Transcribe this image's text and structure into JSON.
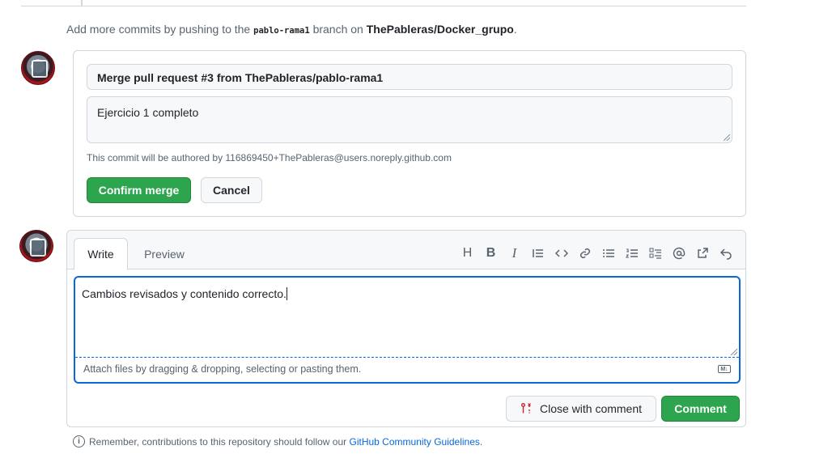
{
  "push_note": {
    "prefix": "Add more commits by pushing to the",
    "branch": "pablo-rama1",
    "middle": "branch on",
    "repo": "ThePableras/Docker_grupo",
    "suffix": "."
  },
  "merge": {
    "title_value": "Merge pull request #3 from ThePableras/pablo-rama1",
    "body_value": "Ejercicio 1 completo",
    "author_note": "This commit will be authored by 116869450+ThePableras@users.noreply.github.com",
    "confirm_label": "Confirm merge",
    "cancel_label": "Cancel"
  },
  "comment": {
    "tabs": [
      {
        "label": "Write",
        "active": true
      },
      {
        "label": "Preview",
        "active": false
      }
    ],
    "toolbar": [
      "heading",
      "bold",
      "italic",
      "quote",
      "code",
      "link",
      "unordered-list",
      "ordered-list",
      "task-list",
      "mention",
      "cross-reference",
      "undo"
    ],
    "text_value": "Cambios revisados y contenido correcto.",
    "attach_note": "Attach files by dragging & dropping, selecting or pasting them.",
    "close_label": "Close with comment",
    "comment_label": "Comment"
  },
  "guidelines": {
    "prefix": "Remember, contributions to this repository should follow our",
    "link": "GitHub Community Guidelines",
    "suffix": "."
  },
  "colors": {
    "accent_blue": "#0969da",
    "merge_green": "#2da44e",
    "close_icon_red": "#cf222e"
  }
}
